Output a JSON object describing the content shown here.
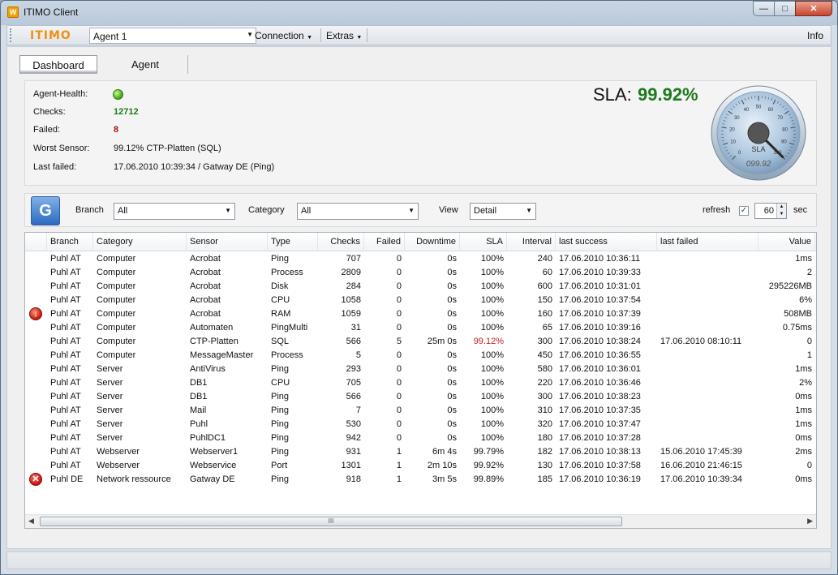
{
  "window": {
    "title": "ITIMO Client",
    "app_icon": "itimo-app-icon",
    "controls": [
      "minimize",
      "maximize",
      "close"
    ]
  },
  "menubar": {
    "logo": "ITIMO",
    "agent_selected": "Agent 1",
    "connection": "Connection",
    "extras": "Extras",
    "info": "Info"
  },
  "tabs": [
    {
      "label": "Dashboard",
      "active": true
    },
    {
      "label": "Agent",
      "active": false
    }
  ],
  "dashboard": {
    "agent_health_label": "Agent-Health:",
    "agent_health_status": "green",
    "checks_label": "Checks:",
    "checks_value": "12712",
    "failed_label": "Failed:",
    "failed_value": "8",
    "worst_sensor_label": "Worst Sensor:",
    "worst_sensor_value": "99.12% CTP-Platten (SQL)",
    "last_failed_label": "Last failed:",
    "last_failed_value": "17.06.2010 10:39:34 / Gatway DE (Ping)",
    "sla_label": "SLA:",
    "sla_value": "99.92%",
    "gauge": {
      "label": "SLA",
      "readout": "099.92",
      "ticks": [
        "0",
        "10",
        "20",
        "30",
        "40",
        "50",
        "60",
        "70",
        "80",
        "90",
        "100"
      ],
      "needle_value": 99.92
    }
  },
  "filters": {
    "branch_label": "Branch",
    "branch_value": "All",
    "category_label": "Category",
    "category_value": "All",
    "view_label": "View",
    "view_value": "Detail",
    "refresh_label": "refresh",
    "refresh_checked": true,
    "refresh_interval": "60",
    "sec_label": "sec"
  },
  "table": {
    "columns": [
      "",
      "Branch",
      "Category",
      "Sensor",
      "Type",
      "Checks",
      "Failed",
      "Downtime",
      "SLA",
      "Interval",
      "last success",
      "last failed",
      "Value"
    ],
    "rows": [
      {
        "status": "",
        "branch": "Puhl AT",
        "category": "Computer",
        "sensor": "Acrobat",
        "type": "Ping",
        "checks": "707",
        "failed": "0",
        "downtime": "0s",
        "sla": "100%",
        "interval": "240",
        "last_success": "17.06.2010 10:36:11",
        "last_failed": "",
        "value": "1ms"
      },
      {
        "status": "",
        "branch": "Puhl AT",
        "category": "Computer",
        "sensor": "Acrobat",
        "type": "Process",
        "checks": "2809",
        "failed": "0",
        "downtime": "0s",
        "sla": "100%",
        "interval": "60",
        "last_success": "17.06.2010 10:39:33",
        "last_failed": "",
        "value": "2"
      },
      {
        "status": "",
        "branch": "Puhl AT",
        "category": "Computer",
        "sensor": "Acrobat",
        "type": "Disk",
        "checks": "284",
        "failed": "0",
        "downtime": "0s",
        "sla": "100%",
        "interval": "600",
        "last_success": "17.06.2010 10:31:01",
        "last_failed": "",
        "value": "295226MB"
      },
      {
        "status": "",
        "branch": "Puhl AT",
        "category": "Computer",
        "sensor": "Acrobat",
        "type": "CPU",
        "checks": "1058",
        "failed": "0",
        "downtime": "0s",
        "sla": "100%",
        "interval": "150",
        "last_success": "17.06.2010 10:37:54",
        "last_failed": "",
        "value": "6%"
      },
      {
        "status": "down",
        "branch": "Puhl AT",
        "category": "Computer",
        "sensor": "Acrobat",
        "type": "RAM",
        "checks": "1059",
        "failed": "0",
        "downtime": "0s",
        "sla": "100%",
        "interval": "160",
        "last_success": "17.06.2010 10:37:39",
        "last_failed": "",
        "value": "508MB"
      },
      {
        "status": "",
        "branch": "Puhl AT",
        "category": "Computer",
        "sensor": "Automaten",
        "type": "PingMulti",
        "checks": "31",
        "failed": "0",
        "downtime": "0s",
        "sla": "100%",
        "interval": "65",
        "last_success": "17.06.2010 10:39:16",
        "last_failed": "",
        "value": "0.75ms"
      },
      {
        "status": "",
        "branch": "Puhl AT",
        "category": "Computer",
        "sensor": "CTP-Platten",
        "type": "SQL",
        "checks": "566",
        "failed": "5",
        "downtime": "25m 0s",
        "sla": "99.12%",
        "sla_bad": true,
        "interval": "300",
        "last_success": "17.06.2010 10:38:24",
        "last_failed": "17.06.2010 08:10:11",
        "value": "0"
      },
      {
        "status": "",
        "branch": "Puhl AT",
        "category": "Computer",
        "sensor": "MessageMaster",
        "type": "Process",
        "checks": "5",
        "failed": "0",
        "downtime": "0s",
        "sla": "100%",
        "interval": "450",
        "last_success": "17.06.2010 10:36:55",
        "last_failed": "",
        "value": "1"
      },
      {
        "status": "",
        "branch": "Puhl AT",
        "category": "Server",
        "sensor": "AntiVirus",
        "type": "Ping",
        "checks": "293",
        "failed": "0",
        "downtime": "0s",
        "sla": "100%",
        "interval": "580",
        "last_success": "17.06.2010 10:36:01",
        "last_failed": "",
        "value": "1ms"
      },
      {
        "status": "",
        "branch": "Puhl AT",
        "category": "Server",
        "sensor": "DB1",
        "type": "CPU",
        "checks": "705",
        "failed": "0",
        "downtime": "0s",
        "sla": "100%",
        "interval": "220",
        "last_success": "17.06.2010 10:36:46",
        "last_failed": "",
        "value": "2%"
      },
      {
        "status": "",
        "branch": "Puhl AT",
        "category": "Server",
        "sensor": "DB1",
        "type": "Ping",
        "checks": "566",
        "failed": "0",
        "downtime": "0s",
        "sla": "100%",
        "interval": "300",
        "last_success": "17.06.2010 10:38:23",
        "last_failed": "",
        "value": "0ms"
      },
      {
        "status": "",
        "branch": "Puhl AT",
        "category": "Server",
        "sensor": "Mail",
        "type": "Ping",
        "checks": "7",
        "failed": "0",
        "downtime": "0s",
        "sla": "100%",
        "interval": "310",
        "last_success": "17.06.2010 10:37:35",
        "last_failed": "",
        "value": "1ms"
      },
      {
        "status": "",
        "branch": "Puhl AT",
        "category": "Server",
        "sensor": "Puhl",
        "type": "Ping",
        "checks": "530",
        "failed": "0",
        "downtime": "0s",
        "sla": "100%",
        "interval": "320",
        "last_success": "17.06.2010 10:37:47",
        "last_failed": "",
        "value": "1ms"
      },
      {
        "status": "",
        "branch": "Puhl AT",
        "category": "Server",
        "sensor": "PuhlDC1",
        "type": "Ping",
        "checks": "942",
        "failed": "0",
        "downtime": "0s",
        "sla": "100%",
        "interval": "180",
        "last_success": "17.06.2010 10:37:28",
        "last_failed": "",
        "value": "0ms"
      },
      {
        "status": "",
        "branch": "Puhl AT",
        "category": "Webserver",
        "sensor": "Webserver1",
        "type": "Ping",
        "checks": "931",
        "failed": "1",
        "downtime": "6m 4s",
        "sla": "99.79%",
        "interval": "182",
        "last_success": "17.06.2010 10:38:13",
        "last_failed": "15.06.2010 17:45:39",
        "value": "2ms"
      },
      {
        "status": "",
        "branch": "Puhl AT",
        "category": "Webserver",
        "sensor": "Webservice",
        "type": "Port",
        "checks": "1301",
        "failed": "1",
        "downtime": "2m 10s",
        "sla": "99.92%",
        "interval": "130",
        "last_success": "17.06.2010 10:37:58",
        "last_failed": "16.06.2010 21:46:15",
        "value": "0"
      },
      {
        "status": "error",
        "branch": "Puhl DE",
        "category": "Network ressource",
        "sensor": "Gatway DE",
        "type": "Ping",
        "checks": "918",
        "failed": "1",
        "downtime": "3m 5s",
        "sla": "99.89%",
        "interval": "185",
        "last_success": "17.06.2010 10:36:19",
        "last_failed": "17.06.2010 10:39:34",
        "value": "0ms"
      }
    ]
  },
  "scrollbar": {
    "thumb_grip": "III"
  },
  "colors": {
    "sla_good": "#1d7a1d",
    "sla_bad": "#c02020",
    "failed_value": "#a01010",
    "checks_value": "#1c7a1c",
    "logo": "#f09010"
  }
}
